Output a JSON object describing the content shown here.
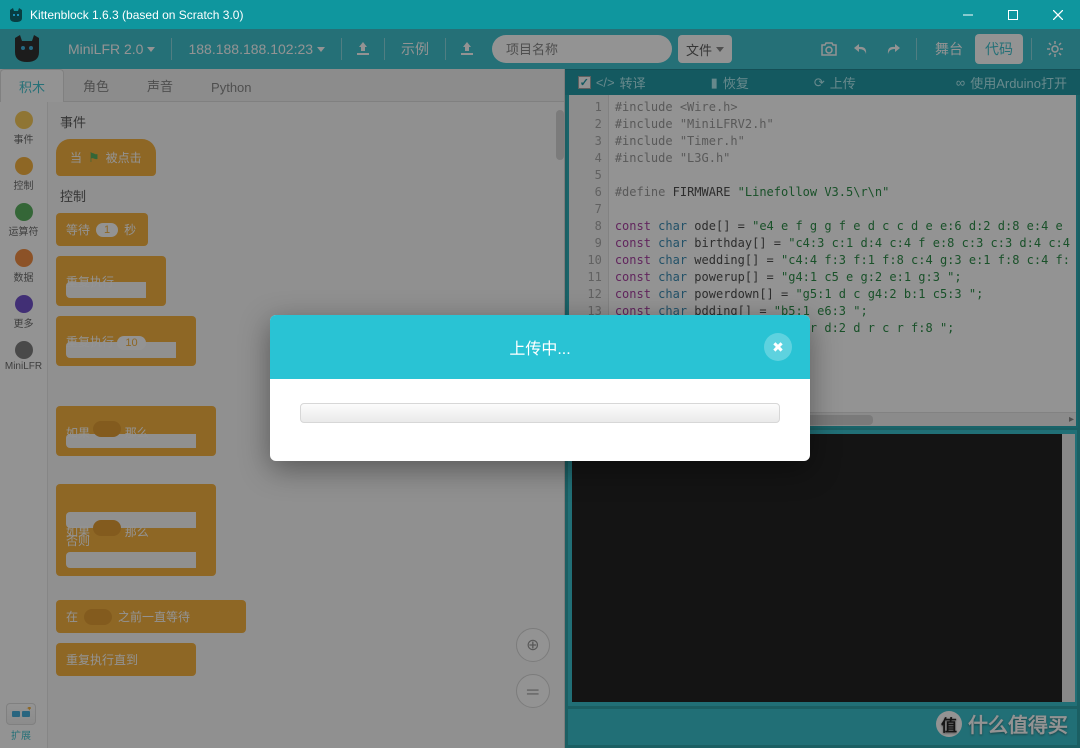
{
  "titlebar": {
    "title": "Kittenblock 1.6.3 (based on Scratch 3.0)"
  },
  "menubar": {
    "board": "MiniLFR 2.0",
    "address": "188.188.188.102:23",
    "example": "示例",
    "search_placeholder": "项目名称",
    "file": "文件",
    "stage": "舞台",
    "code": "代码"
  },
  "actionbar": {
    "translate": "转译",
    "restore": "恢复",
    "upload": "上传",
    "arduino": "使用Arduino打开"
  },
  "tabs": {
    "blocks": "积木",
    "roles": "角色",
    "sounds": "声音",
    "python": "Python"
  },
  "categories": [
    {
      "label": "事件",
      "color": "#f6c341"
    },
    {
      "label": "控制",
      "color": "#f5a623"
    },
    {
      "label": "运算符",
      "color": "#41a447"
    },
    {
      "label": "数据",
      "color": "#f07d26"
    },
    {
      "label": "更多",
      "color": "#5b36c2"
    },
    {
      "label": "MiniLFR",
      "color": "#6a6a6a"
    }
  ],
  "palette": {
    "events_header": "事件",
    "hat_label_prefix": "当",
    "hat_label_suffix": "被点击",
    "control_header": "控制",
    "wait_label": "等待",
    "wait_value": "1",
    "wait_unit": "秒",
    "repeat_label": "重复执行",
    "repeat_n_value": "10",
    "if_label": "如果",
    "then_label": "那么",
    "else_label": "否则",
    "until_prefix": "在",
    "until_suffix": "之前一直等待",
    "repeat_until": "重复执行直到"
  },
  "ext_label": "扩展",
  "code_lines": [
    "#include <Wire.h>",
    "#include \"MiniLFRV2.h\"",
    "#include \"Timer.h\"",
    "#include \"L3G.h\"",
    "",
    "#define FIRMWARE \"Linefollow V3.5\\r\\n\"",
    "",
    "const char ode[] = \"e4 e f g g f e d c c d e e:6 d:2 d:8 e:4 e ",
    "const char birthday[] = \"c4:3 c:1 d:4 c:4 f e:8 c:3 c:3 d:4 c:4",
    "const char wedding[] = \"c4:4 f:3 f:1 f:8 c:4 g:3 e:1 f:8 c:4 f:",
    "const char powerup[] = \"g4:1 c5 e g:2 e:1 g:3 \";",
    "const char powerdown[] = \"g5:1 d c g4:2 b:1 c5:3 \";",
    "const char bdding[] = \"b5:1 e6:3 \";",
    "const char baddy[] = \"c3:3 r d:2 d r c r f:8 \";",
    ""
  ],
  "modal": {
    "title": "上传中..."
  },
  "watermark": {
    "text": "什么值得买",
    "badge": "值"
  }
}
